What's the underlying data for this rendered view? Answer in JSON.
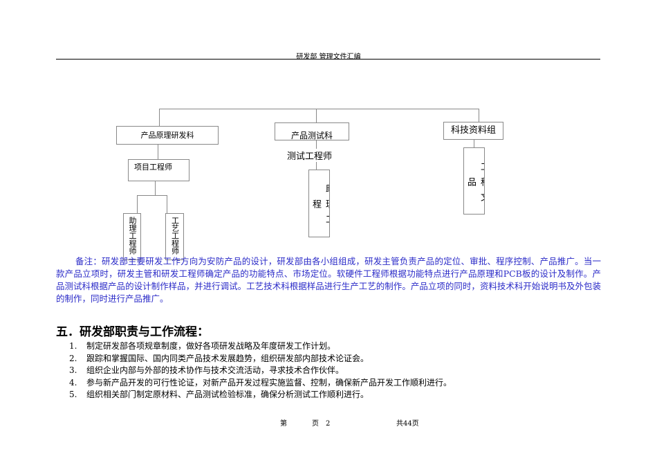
{
  "header": {
    "title": "研发部 管理文件汇编"
  },
  "org_chart": {
    "dept1": "产品原理研发科",
    "dept2": "产品测试科",
    "dept3": "科技资料组",
    "dept1_lead": "项目工程师",
    "dept1_sub1": "助理工程师",
    "dept1_sub2": "工艺工程师",
    "dept2_lead": "测试工程师",
    "dept2_sub": "助理工程",
    "dept3_sub": "工程文品"
  },
  "note": "备注：研发部主要研发工作方向为安防产品的设计，研发部由各小组组成，研发主管负责产品的定位、审批、程序控制、产品推广。当一款产品立项时，研发主管和研发工程师确定产品的功能特点、市场定位。软硬件工程师根据功能特点进行产品原理和PCB板的设计及制作。产品测试科根据产品的设计制作样品，并进行调试。工艺技术科根据样品进行生产工艺的制作。产品立项的同时，资料技术科开始说明书及外包装的制作，同时进行产品推广。",
  "section": {
    "title": "五．研发部职责与工作流程：",
    "items": [
      {
        "num": "1.",
        "text": "制定研发部各项规章制度，做好各项研发战略及年度研发工作计划。"
      },
      {
        "num": "2.",
        "text": "跟踪和掌握国际、国内同类产品技术发展趋势，组织研发部内部技术论证会。"
      },
      {
        "num": "3.",
        "text": "组织企业内部与外部的技术协作与技术交流活动，寻求技术合作伙伴。"
      },
      {
        "num": "4.",
        "text": "参与新产品开发的可行性论证，对新产品开发过程实施监督、控制，确保新产品开发工作顺利进行。"
      },
      {
        "num": "5.",
        "text": "组织相关部门制定原材料、产品测试检验标准，确保分析测试工作顺利进行。"
      }
    ]
  },
  "footer": {
    "page_prefix": "第",
    "page_mid": "页",
    "page_num": "2",
    "total": "共44页"
  }
}
